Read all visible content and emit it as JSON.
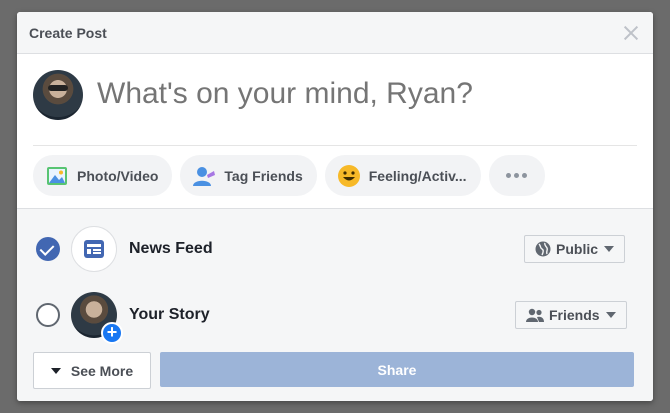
{
  "dialog": {
    "title": "Create Post"
  },
  "composer": {
    "placeholder": "What's on your mind, Ryan?"
  },
  "chips": {
    "photo_video": "Photo/Video",
    "tag_friends": "Tag Friends",
    "feeling": "Feeling/Activ..."
  },
  "destinations": [
    {
      "label": "News Feed",
      "checked": true,
      "privacy": "Public",
      "icon": "news-feed-icon",
      "privacy_icon": "globe-icon"
    },
    {
      "label": "Your Story",
      "checked": false,
      "privacy": "Friends",
      "icon": "avatar",
      "privacy_icon": "friends-icon"
    }
  ],
  "actions": {
    "see_more": "See More",
    "share": "Share"
  },
  "colors": {
    "accent": "#4267b2",
    "share_disabled": "#9cb4d8",
    "story_plus": "#1877f2"
  }
}
